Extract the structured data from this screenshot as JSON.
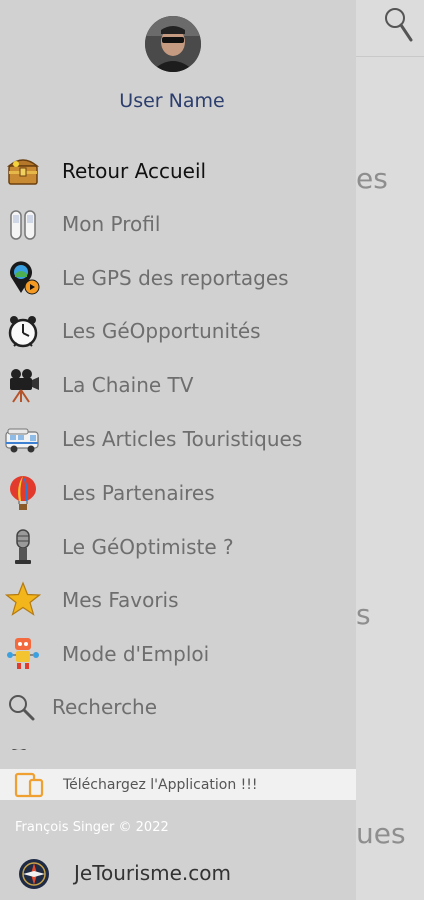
{
  "user": {
    "name": "User Name"
  },
  "menu": [
    {
      "id": "home",
      "label": "Retour Accueil",
      "icon": "treasure-chest-icon",
      "active": true
    },
    {
      "id": "profile",
      "label": "Mon Profil",
      "icon": "shoes-icon"
    },
    {
      "id": "gps",
      "label": "Le GPS des reportages",
      "icon": "map-pin-play-icon"
    },
    {
      "id": "opportunities",
      "label": "Les GéOpportunités",
      "icon": "alarm-clock-icon"
    },
    {
      "id": "tv",
      "label": "La Chaine TV",
      "icon": "movie-camera-icon"
    },
    {
      "id": "articles",
      "label": "Les Articles Touristiques",
      "icon": "camper-van-icon"
    },
    {
      "id": "partners",
      "label": "Les Partenaires",
      "icon": "hot-air-balloon-icon"
    },
    {
      "id": "geoptimist",
      "label": "Le GéOptimiste ?",
      "icon": "microphone-icon"
    },
    {
      "id": "favorites",
      "label": "Mes Favoris",
      "icon": "star-icon"
    },
    {
      "id": "manual",
      "label": "Mode d'Emploi",
      "icon": "robot-icon"
    },
    {
      "id": "search",
      "label": "Recherche",
      "icon": "search-icon"
    }
  ],
  "download": {
    "label": "Téléchargez l'Application !!!",
    "icon": "devices-icon"
  },
  "footer": {
    "copyright": "François Singer © 2022",
    "site": "JeTourisme.com",
    "site_icon": "compass-icon"
  },
  "background": {
    "fragments": [
      "es",
      "s",
      "ues"
    ]
  },
  "colors": {
    "drawer_bg": "#d1d1d1",
    "username": "#2c3e6e",
    "download_bg": "#f1f1f1",
    "download_accent": "#f0a030"
  }
}
